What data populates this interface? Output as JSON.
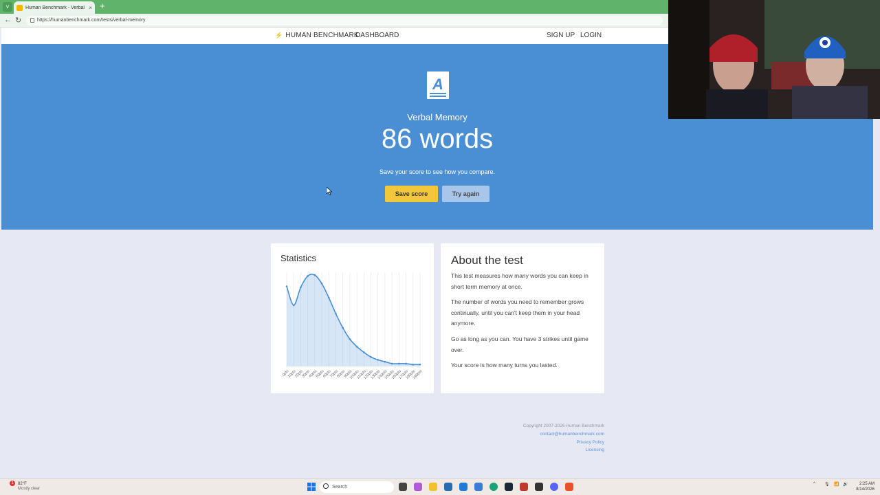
{
  "browser": {
    "tab_title": "Human Benchmark - Verbal Mem...",
    "tab_close": "×",
    "new_tab": "+",
    "url": "https://humanbenchmark.com/tests/verbal-memory",
    "back": "←",
    "reload": "↻",
    "menu": "˅"
  },
  "header": {
    "brand": "HUMAN BENCHMARK",
    "dashboard": "DASHBOARD",
    "signup": "SIGN UP",
    "login": "LOGIN"
  },
  "hero": {
    "icon": "book-icon",
    "test_name": "Verbal Memory",
    "score": "86 words",
    "hint": "Save your score to see how you compare.",
    "save_label": "Save score",
    "try_label": "Try again"
  },
  "stats": {
    "title": "Statistics"
  },
  "chart_data": {
    "type": "area",
    "title": "Statistics",
    "x": [
      "0pts",
      "10pts",
      "20pts",
      "30pts",
      "40pts",
      "50pts",
      "60pts",
      "70pts",
      "80pts",
      "90pts",
      "100pts",
      "110pts",
      "120pts",
      "130pts",
      "140pts",
      "150pts",
      "160pts",
      "170pts",
      "180pts",
      "190pts"
    ],
    "values": [
      0.85,
      0.65,
      0.84,
      0.96,
      0.97,
      0.88,
      0.73,
      0.56,
      0.41,
      0.29,
      0.21,
      0.15,
      0.1,
      0.07,
      0.05,
      0.03,
      0.03,
      0.03,
      0.02,
      0.02
    ],
    "ylim": [
      0,
      1
    ],
    "grid": "vertical",
    "legend": "none"
  },
  "about": {
    "title": "About the test",
    "p1": "This test measures how many words you can keep in short term memory at once.",
    "p2": "The number of words you need to remember grows continually, until you can't keep them in your head anymore.",
    "p3": "Go as long as you can. You have 3 strikes until game over.",
    "p4": "Your score is how many turns you lasted."
  },
  "footer": {
    "copyright": "Copyright 2007-2026 Human Benchmark",
    "email": "contact@humanbenchmark.com",
    "privacy": "Privacy Policy",
    "licensing": "Licensing"
  },
  "taskbar": {
    "weather_temp": "82°F",
    "weather_desc": "Mostly clear",
    "weather_badge": "1",
    "search": "Search",
    "time": "2:25 AM",
    "date": "8/14/2026"
  },
  "colors": {
    "hero_bg": "#4a8fd4",
    "save_btn": "#f3c73c",
    "try_btn": "#a8c6ea",
    "chart_line": "#4a8fd4"
  }
}
